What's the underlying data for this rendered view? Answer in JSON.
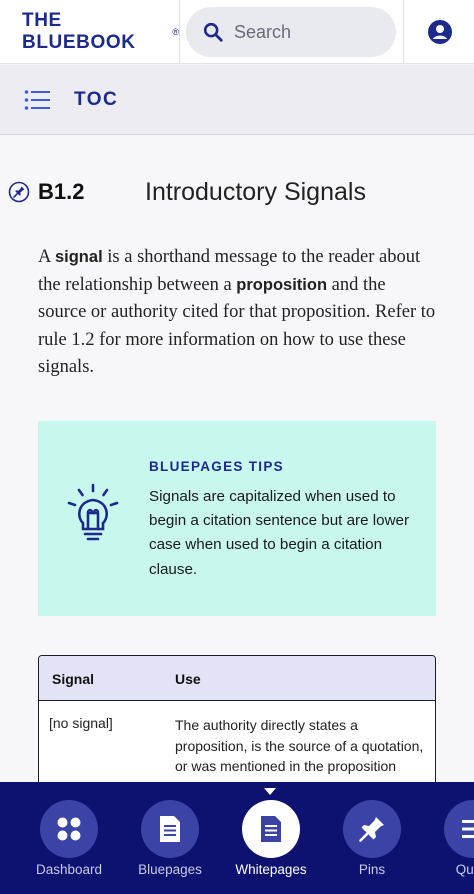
{
  "header": {
    "brand": "THE BLUEBOOK",
    "brand_mark": "®",
    "search_placeholder": "Search"
  },
  "toc": {
    "label": "TOC"
  },
  "rule": {
    "number": "B1.2",
    "title": "Introductory Signals"
  },
  "intro": {
    "segments": [
      "A ",
      "signal",
      " is a shorthand message to the reader about the relationship between a ",
      "proposition",
      " and the source or authority cited for that proposition. Refer to rule 1.2 for more information on how to use these signals."
    ]
  },
  "tip": {
    "title": "BLUEPAGES TIPS",
    "body": "Signals are capitalized when used to begin a citation sentence but are lower case when used to begin a citation clause."
  },
  "table": {
    "headers": [
      "Signal",
      "Use"
    ],
    "rows": [
      {
        "signal": "[no signal]",
        "use": "The authority directly states a proposition, is the source of a quotation, or was mentioned in the proposition"
      }
    ]
  },
  "bottom_nav": {
    "items": [
      {
        "label": "Dashboard",
        "icon": "dashboard-icon",
        "active": false
      },
      {
        "label": "Bluepages",
        "icon": "document-icon",
        "active": false
      },
      {
        "label": "Whitepages",
        "icon": "document-icon",
        "active": true
      },
      {
        "label": "Pins",
        "icon": "pin-icon",
        "active": false
      },
      {
        "label": "Quick",
        "icon": "menu-icon",
        "active": false
      }
    ]
  },
  "colors": {
    "brand_navy": "#1c2a8c",
    "nav_background": "#0d1270",
    "nav_circle": "#3b43a6",
    "tip_background": "#c8f7ee",
    "table_header_bg": "#e2e4f6"
  }
}
